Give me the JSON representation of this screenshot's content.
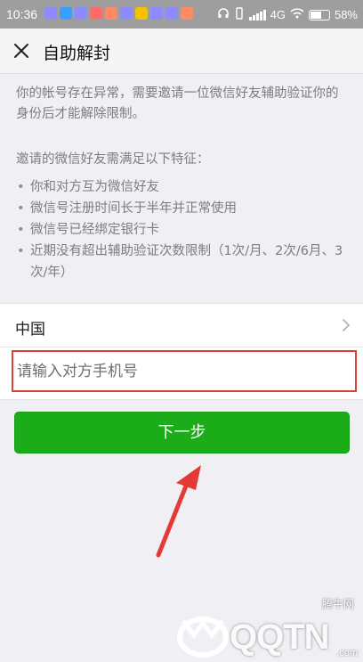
{
  "status_bar": {
    "time": "10:36",
    "network": "4G",
    "battery": "58%",
    "app_icon_colors": [
      "#8e8aff",
      "#3aa0ff",
      "#8e8aff",
      "#ff6b6b",
      "#ff8a65",
      "#8e8aff",
      "#f5c400",
      "#8e8aff",
      "#8e8aff",
      "#ff8a65"
    ]
  },
  "header": {
    "title": "自助解封",
    "close_icon": "close-icon"
  },
  "intro": {
    "text": "你的帐号存在异常，需要邀请一位微信好友辅助验证你的身份后才能解除限制。"
  },
  "requirements": {
    "title": "邀请的微信好友需满足以下特征：",
    "items": [
      "你和对方互为微信好友",
      "微信号注册时间长于半年并正常使用",
      "微信号已经绑定银行卡",
      "近期没有超出辅助验证次数限制（1次/月、2次/6月、3次/年）"
    ]
  },
  "form": {
    "country": "中国",
    "phone_placeholder": "请输入对方手机号",
    "phone_value": ""
  },
  "next_button": {
    "label": "下一步",
    "color": "#1aad19"
  },
  "annotation": {
    "highlight_color": "#d9413b",
    "arrow_color": "#e53935"
  },
  "watermark": {
    "brand": "腾牛网",
    "text": "QQTN",
    "domain": ".com"
  }
}
